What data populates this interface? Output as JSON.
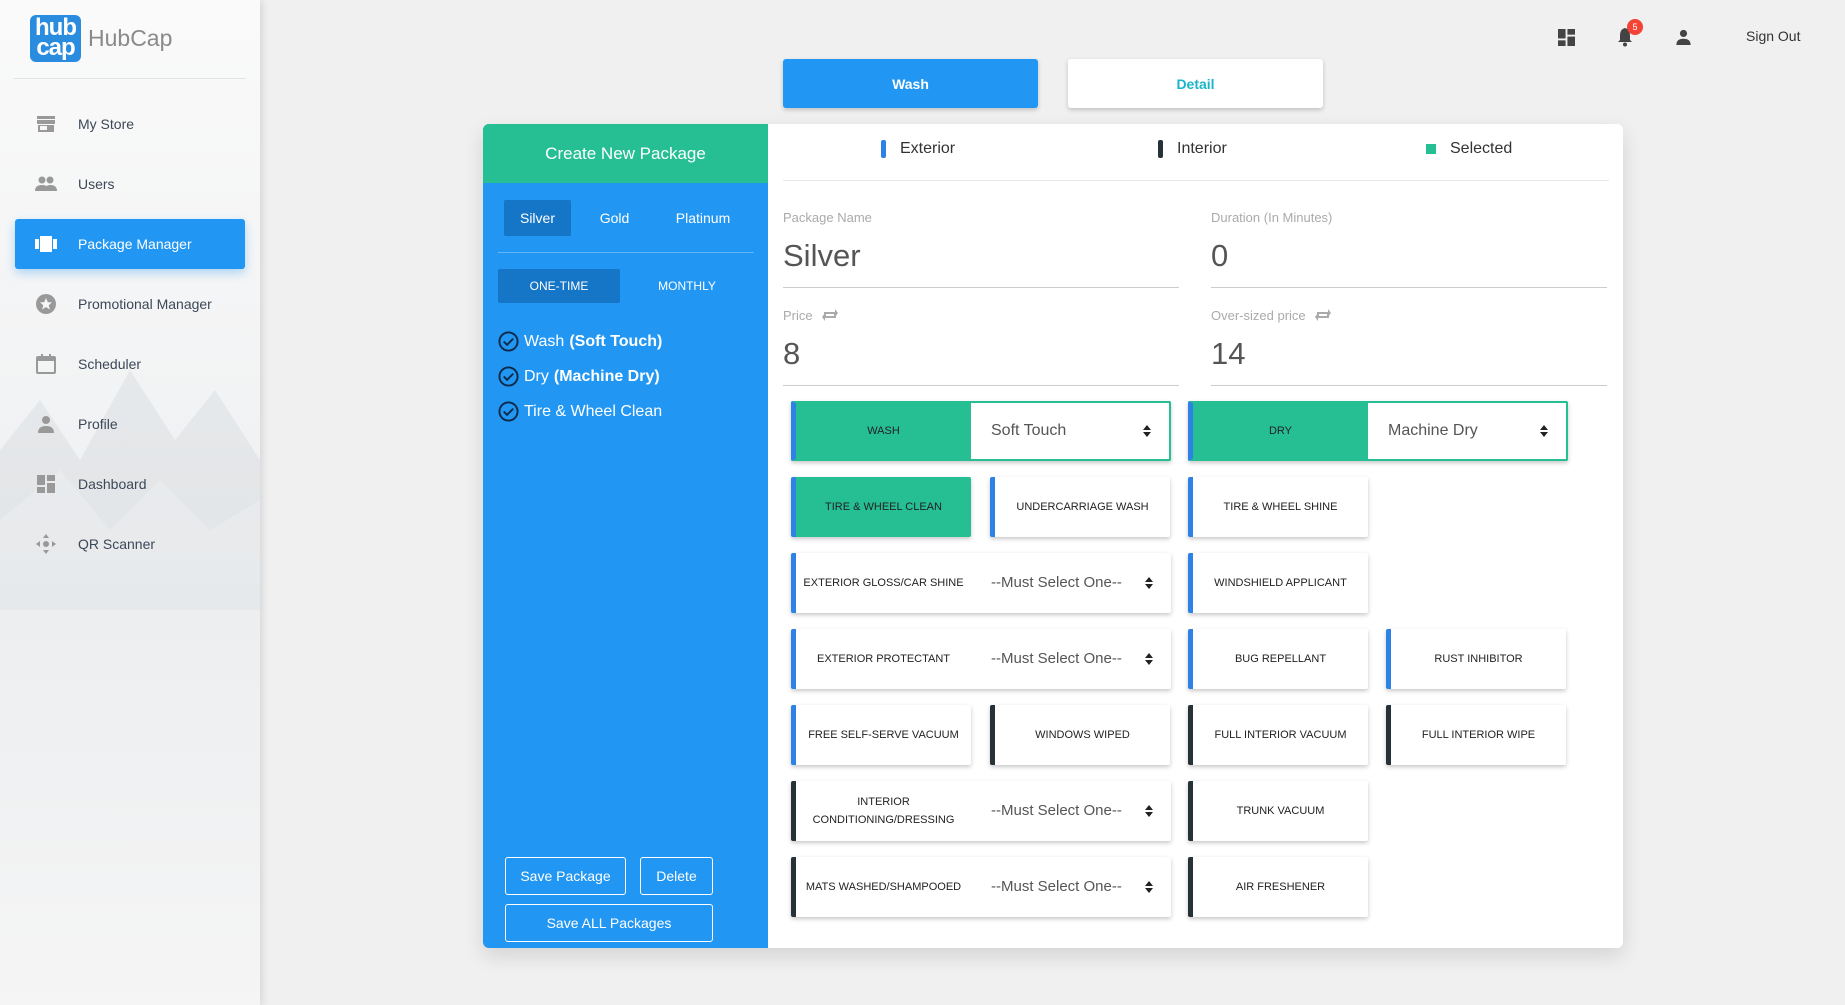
{
  "app": {
    "logo_top": "hub",
    "logo_bottom": "cap",
    "name": "HubCap"
  },
  "sidebar": {
    "items": [
      {
        "label": "My Store",
        "icon": "store-icon",
        "active": false
      },
      {
        "label": "Users",
        "icon": "users-icon",
        "active": false
      },
      {
        "label": "Package Manager",
        "icon": "package-icon",
        "active": true
      },
      {
        "label": "Promotional Manager",
        "icon": "star-icon",
        "active": false
      },
      {
        "label": "Scheduler",
        "icon": "calendar-icon",
        "active": false
      },
      {
        "label": "Profile",
        "icon": "person-icon",
        "active": false
      },
      {
        "label": "Dashboard",
        "icon": "dashboard-icon",
        "active": false
      },
      {
        "label": "QR Scanner",
        "icon": "qr-scanner-icon",
        "active": false
      }
    ]
  },
  "topbar": {
    "notification_count": "5",
    "sign_out": "Sign Out"
  },
  "top_tabs": {
    "wash": "Wash",
    "detail": "Detail"
  },
  "left_panel": {
    "header": "Create New Package",
    "tiers": [
      "Silver",
      "Gold",
      "Platinum"
    ],
    "frequencies": [
      "ONE-TIME",
      "MONTHLY"
    ],
    "services": [
      {
        "name": "Wash",
        "detail": "(Soft Touch)"
      },
      {
        "name": "Dry",
        "detail": "(Machine Dry)"
      },
      {
        "name": "Tire & Wheel Clean",
        "detail": ""
      }
    ],
    "save_package": "Save Package",
    "delete": "Delete",
    "save_all": "Save ALL Packages"
  },
  "legend": {
    "exterior": "Exterior",
    "interior": "Interior",
    "selected": "Selected"
  },
  "form": {
    "package_name_label": "Package Name",
    "package_name": "Silver",
    "duration_label": "Duration (In Minutes)",
    "duration": "0",
    "price_label": "Price",
    "price": "8",
    "oversized_label": "Over-sized price",
    "oversized": "14"
  },
  "options": {
    "wash_label": "WASH",
    "wash_value": "Soft Touch",
    "dry_label": "DRY",
    "dry_value": "Machine Dry",
    "must_select": "--Must Select One--",
    "tire_wheel_clean": "TIRE & WHEEL CLEAN",
    "undercarriage_wash": "UNDERCARRIAGE WASH",
    "tire_wheel_shine": "TIRE & WHEEL SHINE",
    "exterior_gloss": "EXTERIOR GLOSS/CAR SHINE",
    "windshield": "WINDSHIELD APPLICANT",
    "exterior_protectant": "EXTERIOR PROTECTANT",
    "bug_repellant": "BUG REPELLANT",
    "rust_inhibitor": "RUST INHIBITOR",
    "free_vacuum": "FREE SELF-SERVE VACUUM",
    "windows_wiped": "WINDOWS WIPED",
    "full_interior_vacuum": "FULL INTERIOR VACUUM",
    "full_interior_wipe": "FULL INTERIOR WIPE",
    "interior_conditioning": "INTERIOR CONDITIONING/DRESSING",
    "trunk_vacuum": "TRUNK VACUUM",
    "mats_washed": "MATS WASHED/SHAMPOOED",
    "air_freshener": "AIR FRESHENER"
  },
  "colors": {
    "primary": "#2196f3",
    "green": "#25bf93",
    "exterior": "#2e82e6",
    "interior": "#263238"
  }
}
